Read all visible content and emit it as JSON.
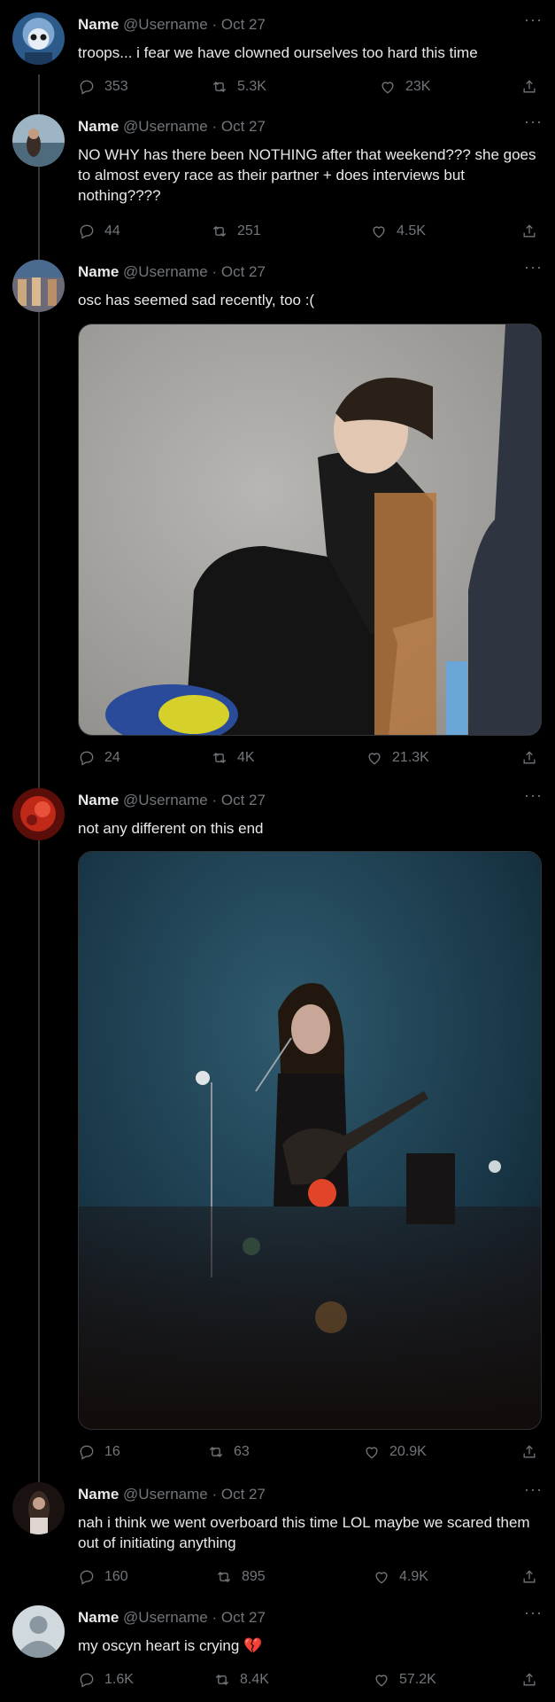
{
  "tweets": [
    {
      "name": "Name",
      "handle": "@Username",
      "date": "Oct 27",
      "text": "troops... i fear we have clowned ourselves too hard this time",
      "replies": "353",
      "retweets": "5.3K",
      "likes": "23K"
    },
    {
      "name": "Name",
      "handle": "@Username",
      "date": "Oct 27",
      "text": "NO WHY has there been NOTHING after that weekend??? she goes to almost every race as their partner + does interviews but nothing????",
      "replies": "44",
      "retweets": "251",
      "likes": "4.5K"
    },
    {
      "name": "Name",
      "handle": "@Username",
      "date": "Oct 27",
      "text": "osc has seemed sad recently, too :(",
      "replies": "24",
      "retweets": "4K",
      "likes": "21.3K"
    },
    {
      "name": "Name",
      "handle": "@Username",
      "date": "Oct 27",
      "text": "not any different on this end",
      "replies": "16",
      "retweets": "63",
      "likes": "20.9K"
    },
    {
      "name": "Name",
      "handle": "@Username",
      "date": "Oct 27",
      "text": "nah i think we went overboard this time LOL maybe we scared them out of initiating anything",
      "replies": "160",
      "retweets": "895",
      "likes": "4.9K"
    },
    {
      "name": "Name",
      "handle": "@Username",
      "date": "Oct 27",
      "text": "my oscyn heart is crying",
      "emoji": "💔",
      "replies": "1.6K",
      "retweets": "8.4K",
      "likes": "57.2K"
    }
  ],
  "ui": {
    "more": "···",
    "dot": "·"
  },
  "colors": {
    "background": "#000000",
    "text": "#e7e9ea",
    "muted": "#71767b",
    "thread": "#333639"
  }
}
